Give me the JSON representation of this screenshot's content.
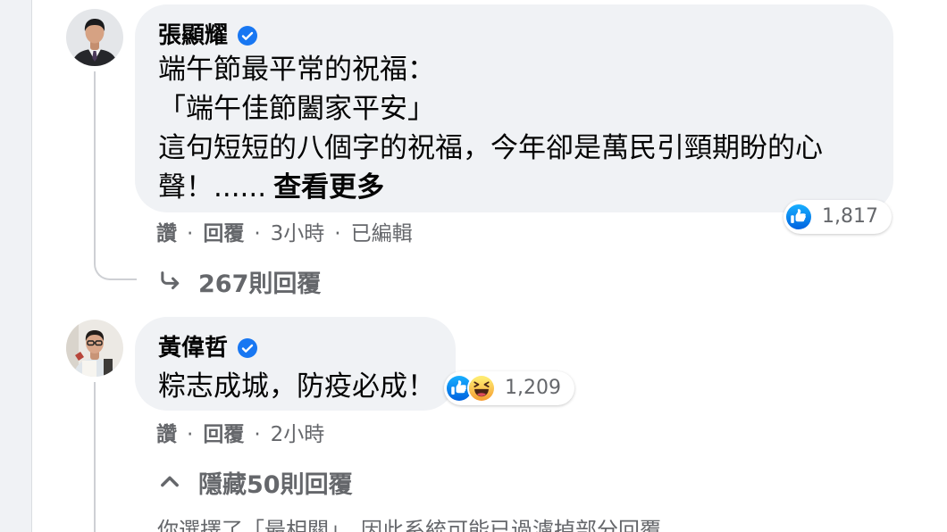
{
  "colors": {
    "page_bg": "#ffffff",
    "side_bg": "#f0f2f5",
    "bubble_bg": "#f0f2f5",
    "text_primary": "#050505",
    "text_secondary": "#65676b",
    "accent_blue": "#1877f2",
    "thread_line": "#ced0d4"
  },
  "separator": "·",
  "comments": [
    {
      "author": "張顯耀",
      "badge_icon": "verified-badge-icon",
      "body_lines": [
        "端午節最平常的祝福：",
        "「端午佳節闔家平安」",
        "這句短短的八個字的祝福，今年卻是萬民引頸期盼的心"
      ],
      "body_last_line": "聲！......",
      "see_more": "查看更多",
      "reactions": {
        "icons": [
          "like-icon"
        ],
        "count": "1,817"
      },
      "actions": {
        "like": "讚",
        "reply": "回覆",
        "time": "3小時",
        "edited": "已編輯"
      },
      "replies": {
        "icon": "reply-arrow-icon",
        "label": "267則回覆"
      }
    },
    {
      "author": "黃偉哲",
      "badge_icon": "verified-badge-icon",
      "body_lines": [
        "粽志成城，防疫必成！"
      ],
      "reactions": {
        "icons": [
          "like-icon",
          "haha-icon"
        ],
        "count": "1,209"
      },
      "actions": {
        "like": "讚",
        "reply": "回覆",
        "time": "2小時"
      },
      "replies": {
        "icon": "chevron-up-icon",
        "label": "隱藏50則回覆"
      }
    }
  ],
  "filter_notice": "你選擇了「最相關」，因此系統可能已過濾掉部分回覆。"
}
